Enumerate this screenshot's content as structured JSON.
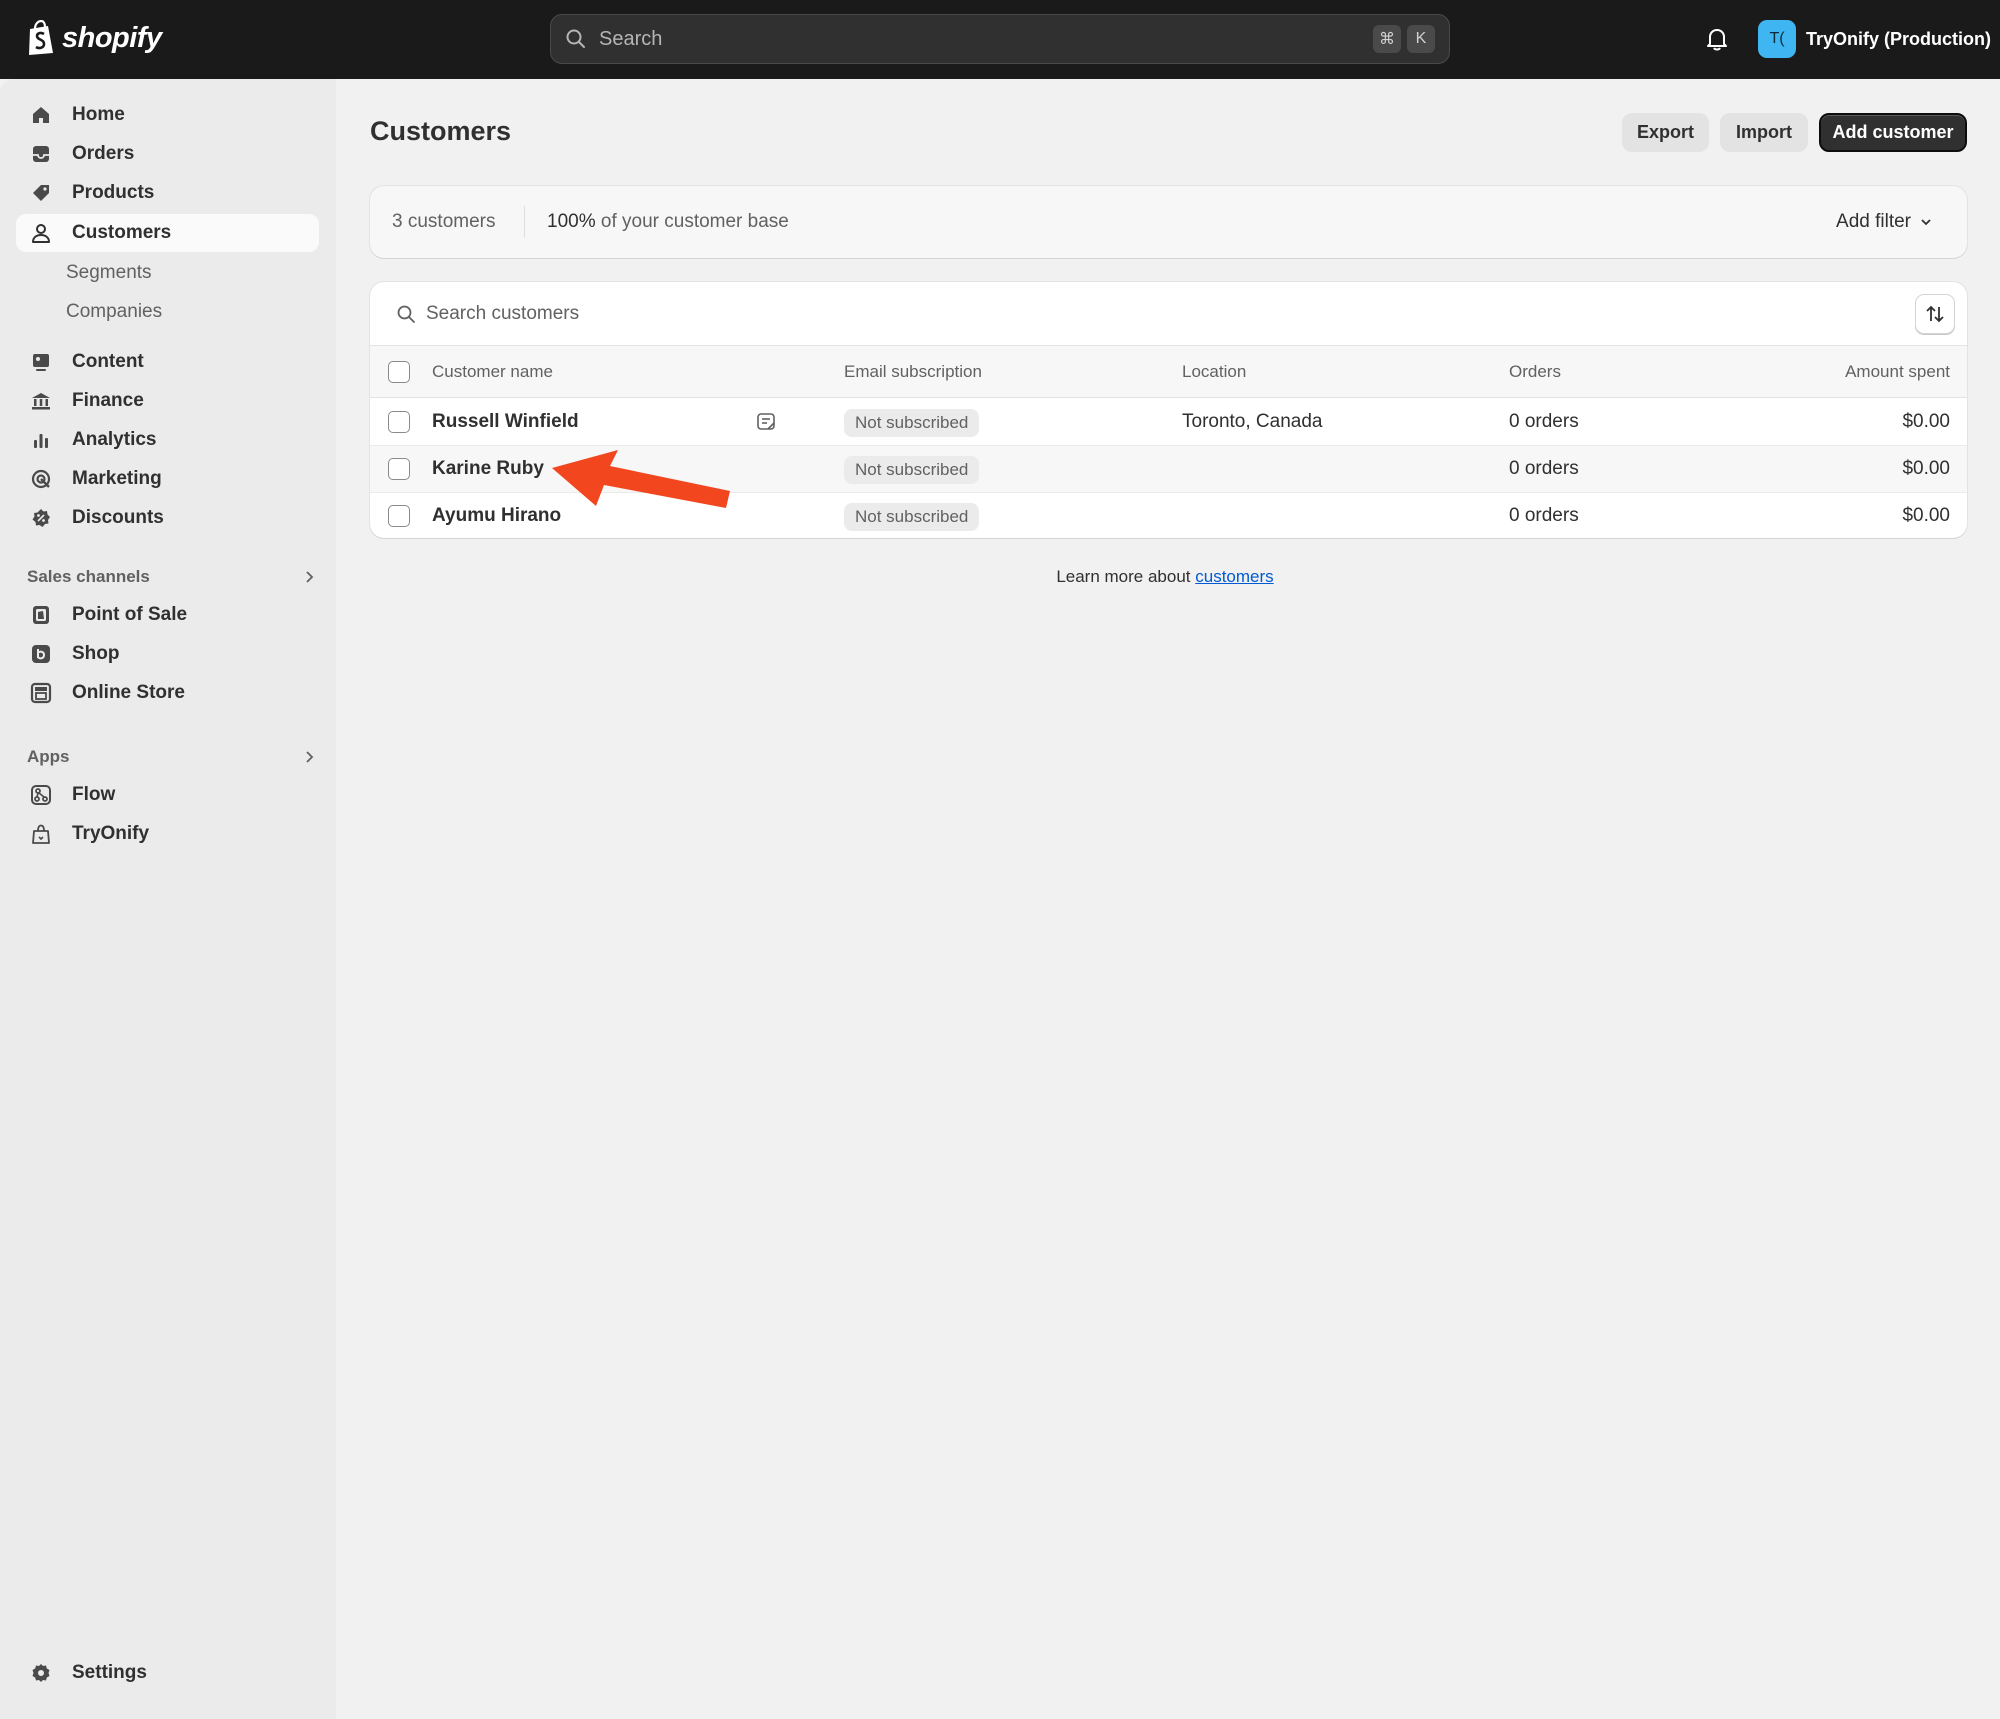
{
  "topbar": {
    "logo_text": "shopify",
    "search_placeholder": "Search",
    "shortcut_keys": [
      "⌘",
      "K"
    ],
    "store_initials": "T(",
    "store_name": "TryOnify (Production)"
  },
  "sidebar": {
    "main_items": [
      {
        "label": "Home",
        "icon": "home-icon"
      },
      {
        "label": "Orders",
        "icon": "inbox-icon"
      },
      {
        "label": "Products",
        "icon": "tag-icon"
      },
      {
        "label": "Customers",
        "icon": "person-icon",
        "active": true
      }
    ],
    "customers_sub": [
      "Segments",
      "Companies"
    ],
    "secondary_items": [
      {
        "label": "Content",
        "icon": "content-icon"
      },
      {
        "label": "Finance",
        "icon": "bank-icon"
      },
      {
        "label": "Analytics",
        "icon": "bar-chart-icon"
      },
      {
        "label": "Marketing",
        "icon": "target-icon"
      },
      {
        "label": "Discounts",
        "icon": "discount-icon"
      }
    ],
    "sales_channels_title": "Sales channels",
    "sales_channels": [
      {
        "label": "Point of Sale",
        "icon": "pos-icon"
      },
      {
        "label": "Shop",
        "icon": "shop-icon"
      },
      {
        "label": "Online Store",
        "icon": "store-icon"
      }
    ],
    "apps_title": "Apps",
    "apps": [
      {
        "label": "Flow",
        "icon": "flow-icon"
      },
      {
        "label": "TryOnify",
        "icon": "bag-icon"
      }
    ],
    "settings_label": "Settings"
  },
  "main": {
    "title": "Customers",
    "export_label": "Export",
    "import_label": "Import",
    "add_customer_label": "Add customer",
    "summary": {
      "count_text": "3 customers",
      "base_percent": "100%",
      "base_text": "of your customer base",
      "add_filter_label": "Add filter"
    },
    "table": {
      "search_placeholder": "Search customers",
      "columns": [
        "Customer name",
        "Email subscription",
        "Location",
        "Orders",
        "Amount spent"
      ],
      "rows": [
        {
          "name": "Russell Winfield",
          "has_note": true,
          "subscription": "Not subscribed",
          "location": "Toronto, Canada",
          "orders": "0 orders",
          "amount": "$0.00"
        },
        {
          "name": "Karine Ruby",
          "has_note": false,
          "subscription": "Not subscribed",
          "location": "",
          "orders": "0 orders",
          "amount": "$0.00"
        },
        {
          "name": "Ayumu Hirano",
          "has_note": false,
          "subscription": "Not subscribed",
          "location": "",
          "orders": "0 orders",
          "amount": "$0.00"
        }
      ]
    },
    "learn_more_text": "Learn more about",
    "learn_more_link": "customers"
  },
  "colors": {
    "topbar": "#1a1a1a",
    "sidebar": "#ebebeb",
    "page": "#f1f1f1",
    "primary_button": "#303030",
    "store_avatar": "#3fb5f1",
    "link": "#005bd3",
    "annotation_arrow": "#f2461f"
  }
}
